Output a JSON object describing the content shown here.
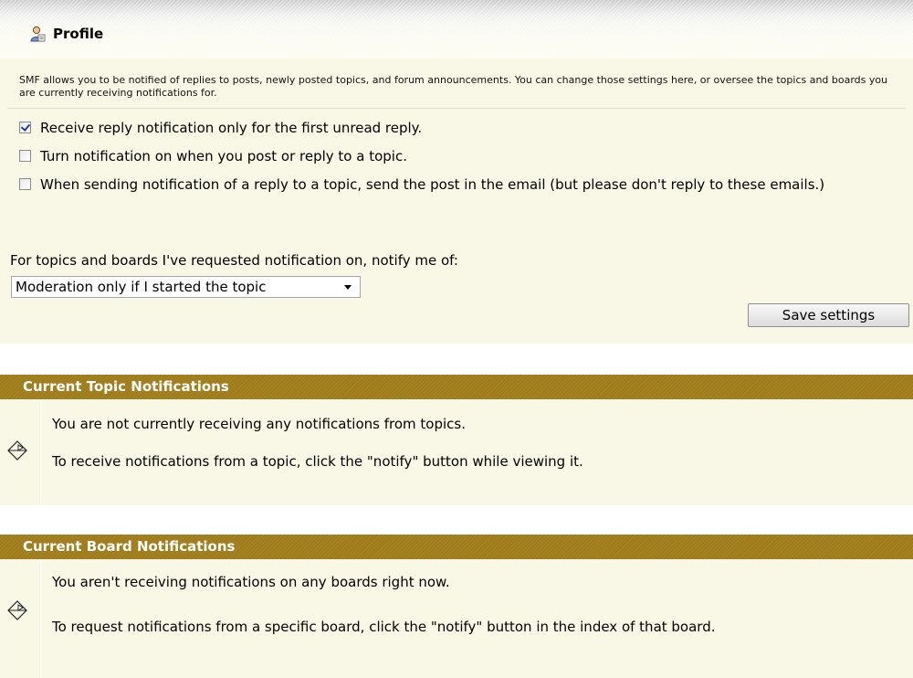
{
  "profile": {
    "title": "Profile",
    "icon": "user-profile-icon"
  },
  "settings": {
    "intro": "SMF allows you to be notified of replies to posts, newly posted topics, and forum announcements. You can change those settings here, or oversee the topics and boards you are currently receiving notifications for.",
    "options": [
      {
        "label": "Receive reply notification only for the first unread reply.",
        "checked": true
      },
      {
        "label": "Turn notification on when you post or reply to a topic.",
        "checked": false
      },
      {
        "label": "When sending notification of a reply to a topic, send the post in the email (but please don't reply to these emails.)",
        "checked": false
      }
    ],
    "notify_label": "For topics and boards I've requested notification on, notify me of:",
    "notify_select_value": "Moderation only if I started the topic",
    "save_label": "Save settings"
  },
  "topic_notifications": {
    "header": "Current Topic Notifications",
    "icon": "notify-diamond-icon",
    "message": "You are not currently receiving any notifications from topics.",
    "hint": "To receive notifications from a topic, click the \"notify\" button while viewing it."
  },
  "board_notifications": {
    "header": "Current Board Notifications",
    "icon": "notify-diamond-icon",
    "message": "You aren't receiving notifications on any boards right now.",
    "hint": "To request notifications from a specific board, click the \"notify\" button in the index of that board."
  },
  "colors": {
    "header_bar": "#9f7b1a",
    "panel_bg": "#f9f8e6",
    "header_text": "#ffffff"
  }
}
